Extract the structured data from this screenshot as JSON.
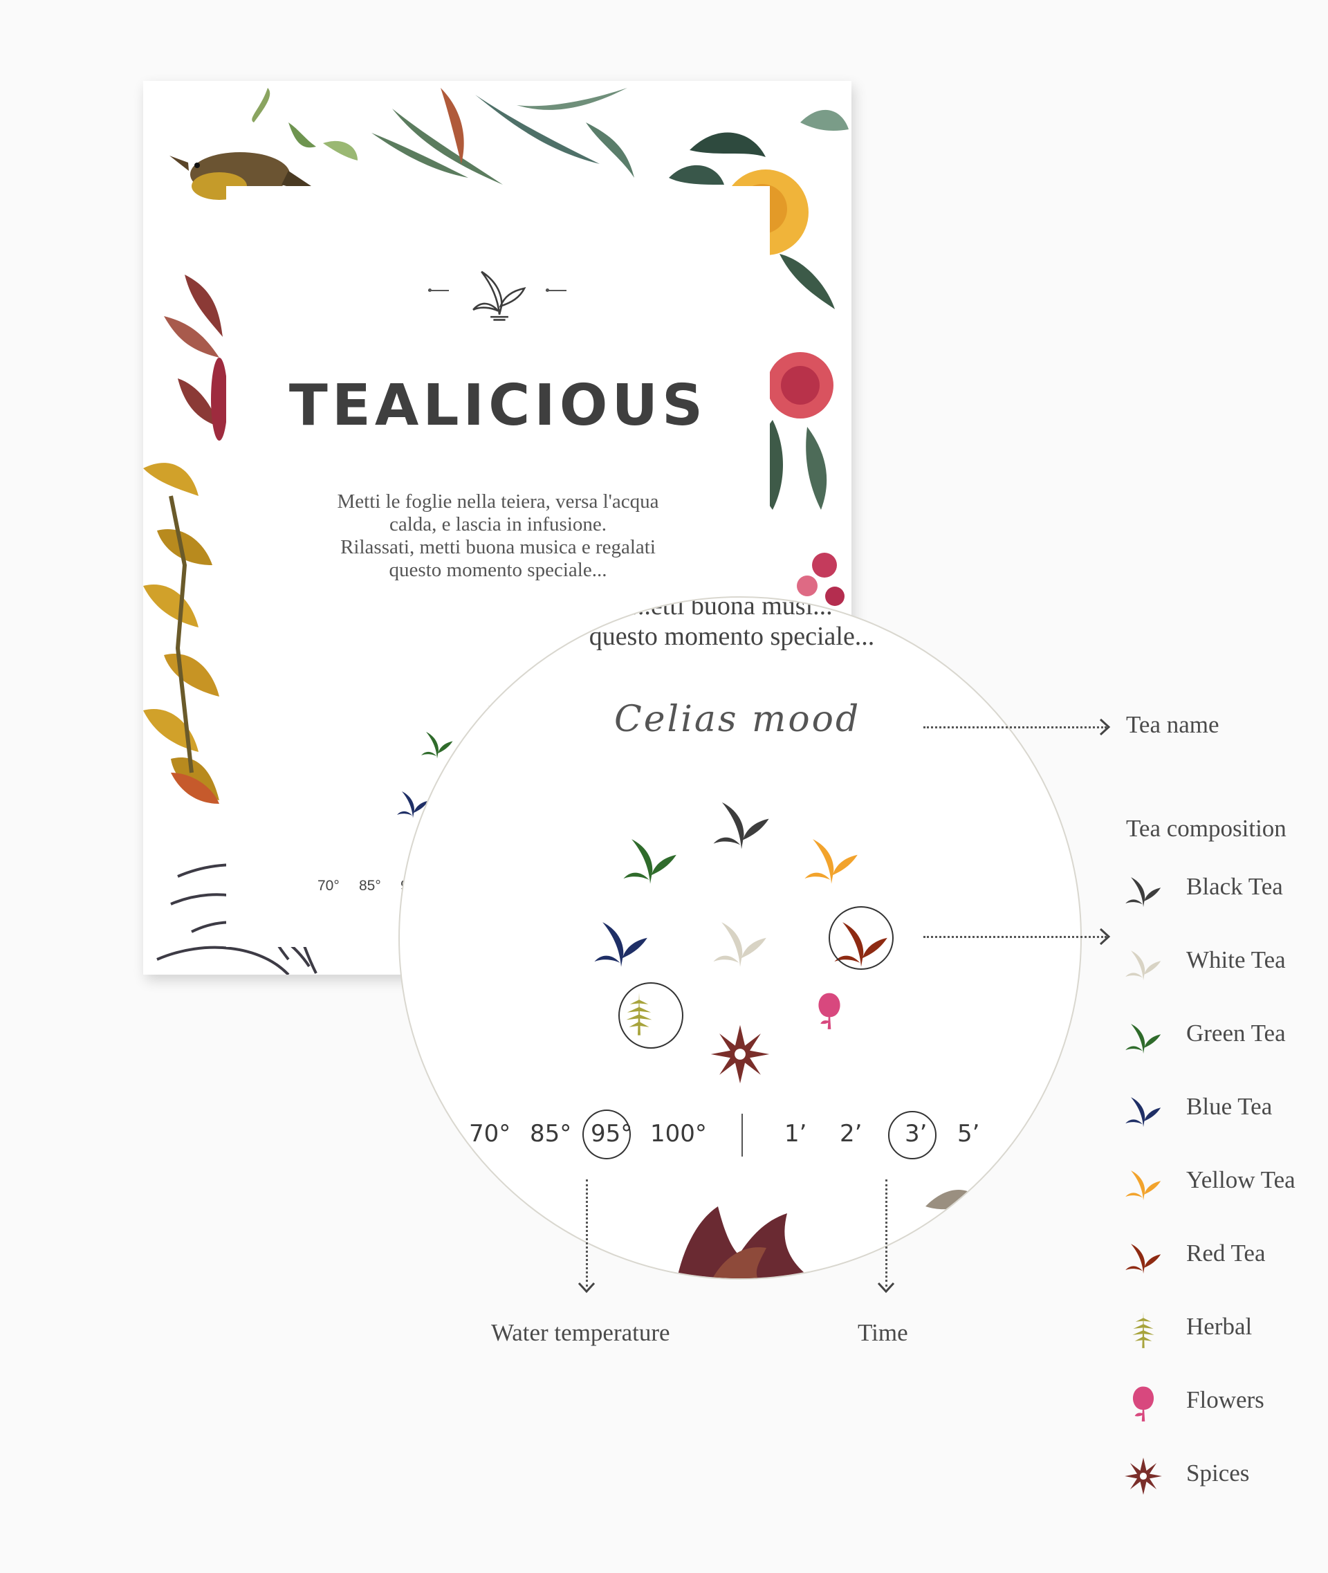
{
  "card": {
    "brand": "TEALICIOUS",
    "intro_lines": [
      "Metti le foglie nella teiera, versa l'acqua",
      "calda, e lascia in infusione.",
      "Rilassati, metti buona musica e regalati",
      "questo momento speciale..."
    ],
    "temps_partial": [
      "70°",
      "85°",
      "95"
    ]
  },
  "lens": {
    "intro_lines": [
      "...etti buona musi...",
      "questo momento speciale..."
    ],
    "tea_name": "Celias mood",
    "temperatures": [
      "70°",
      "85°",
      "95°",
      "100°"
    ],
    "times": [
      "1’",
      "2’",
      "3’",
      "5’"
    ],
    "selected_temperature": "95°",
    "selected_time": "3’"
  },
  "annotations": {
    "tea_name": "Tea name",
    "tea_composition": "Tea composition",
    "water_temperature": "Water temperature",
    "time": "Time"
  },
  "legend": [
    {
      "label": "Black Tea",
      "color": "#3d3d3d",
      "icon": "leaf-icon"
    },
    {
      "label": "White Tea",
      "color": "#d8d3c4",
      "icon": "leaf-icon"
    },
    {
      "label": "Green Tea",
      "color": "#2f6b2b",
      "icon": "leaf-icon"
    },
    {
      "label": "Blue Tea",
      "color": "#1f2f66",
      "icon": "leaf-icon"
    },
    {
      "label": "Yellow Tea",
      "color": "#f2a32c",
      "icon": "leaf-icon"
    },
    {
      "label": "Red Tea",
      "color": "#8e2a12",
      "icon": "leaf-icon"
    },
    {
      "label": "Herbal",
      "color": "#a7a33b",
      "icon": "herb-icon"
    },
    {
      "label": "Flowers",
      "color": "#d8487e",
      "icon": "flower-icon"
    },
    {
      "label": "Spices",
      "color": "#7a2e2a",
      "icon": "star-anise-icon"
    }
  ]
}
